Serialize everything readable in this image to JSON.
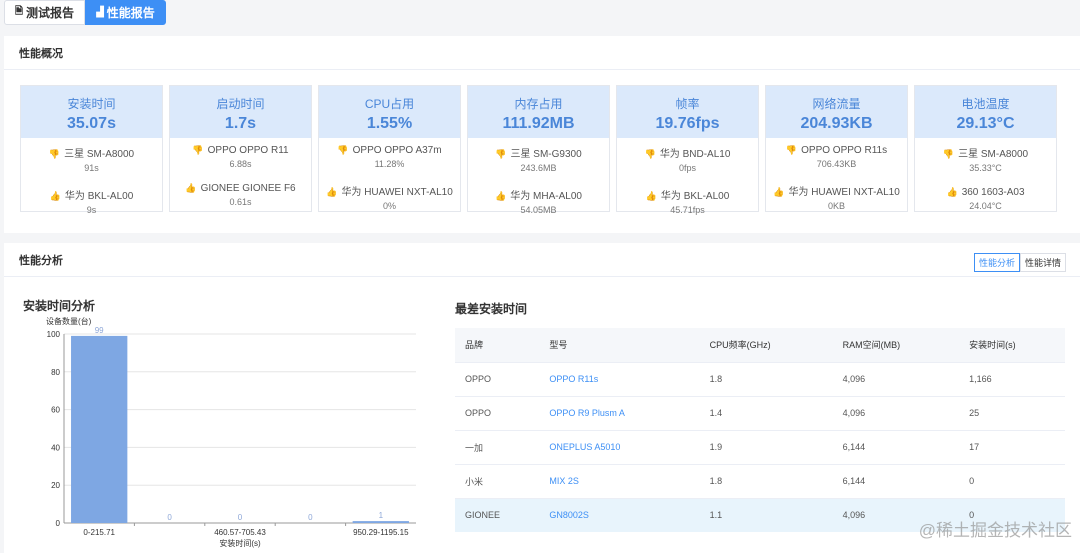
{
  "tabs": [
    {
      "label": "测试报告",
      "icon": "document-icon"
    },
    {
      "label": "性能报告",
      "icon": "bar-chart-icon",
      "active": true
    }
  ],
  "overview": {
    "title": "性能概况",
    "cards": [
      {
        "title": "安装时间",
        "value": "35.07s",
        "worst": {
          "device": "三星 SM-A8000",
          "value": "91s"
        },
        "best": {
          "device": "华为 BKL-AL00",
          "value": "9s"
        }
      },
      {
        "title": "启动时间",
        "value": "1.7s",
        "worst": {
          "device": "OPPO OPPO R11",
          "value": "6.88s"
        },
        "best": {
          "device": "GIONEE GIONEE F6",
          "value": "0.61s"
        }
      },
      {
        "title": "CPU占用",
        "value": "1.55%",
        "worst": {
          "device": "OPPO OPPO A37m",
          "value": "11.28%"
        },
        "best": {
          "device": "华为 HUAWEI NXT-AL10",
          "value": "0%"
        }
      },
      {
        "title": "内存占用",
        "value": "111.92MB",
        "worst": {
          "device": "三星 SM-G9300",
          "value": "243.6MB"
        },
        "best": {
          "device": "华为 MHA-AL00",
          "value": "54.05MB"
        }
      },
      {
        "title": "帧率",
        "value": "19.76fps",
        "worst": {
          "device": "华为 BND-AL10",
          "value": "0fps"
        },
        "best": {
          "device": "华为 BKL-AL00",
          "value": "45.71fps"
        }
      },
      {
        "title": "网络流量",
        "value": "204.93KB",
        "worst": {
          "device": "OPPO OPPO R11s",
          "value": "706.43KB"
        },
        "best": {
          "device": "华为 HUAWEI NXT-AL10",
          "value": "0KB"
        }
      },
      {
        "title": "电池温度",
        "value": "29.13°C",
        "worst": {
          "device": "三星 SM-A8000",
          "value": "35.33°C"
        },
        "best": {
          "device": "360 1603-A03",
          "value": "24.04°C"
        }
      }
    ]
  },
  "analysis": {
    "title": "性能分析",
    "toggle": [
      "性能分析",
      "性能详情"
    ],
    "chart_title": "安装时间分析",
    "table_title": "最差安装时间",
    "table": {
      "headers": [
        "品牌",
        "型号",
        "CPU频率(GHz)",
        "RAM空间(MB)",
        "安装时间(s)"
      ],
      "rows": [
        [
          "OPPO",
          "OPPO R11s",
          "1.8",
          "4,096",
          "1,166"
        ],
        [
          "OPPO",
          "OPPO R9 Plusm A",
          "1.4",
          "4,096",
          "25"
        ],
        [
          "一加",
          "ONEPLUS A5010",
          "1.9",
          "6,144",
          "17"
        ],
        [
          "小米",
          "MIX 2S",
          "1.8",
          "6,144",
          "0"
        ],
        [
          "GIONEE",
          "GN8002S",
          "1.1",
          "4,096",
          "0"
        ]
      ]
    }
  },
  "watermark": "@稀土掘金技术社区",
  "chart_data": {
    "type": "bar",
    "categories": [
      "0-215.71",
      "",
      "460.57-705.43",
      "",
      "950.29-1195.15"
    ],
    "values": [
      99,
      0,
      0,
      0,
      1
    ],
    "xlabel": "安装时间(s)",
    "ylabel": "设备数量(台)",
    "ylim": [
      0,
      100
    ],
    "yticks": [
      0,
      20,
      40,
      60,
      80,
      100
    ],
    "grid": true,
    "color": "#7ea7e3"
  }
}
